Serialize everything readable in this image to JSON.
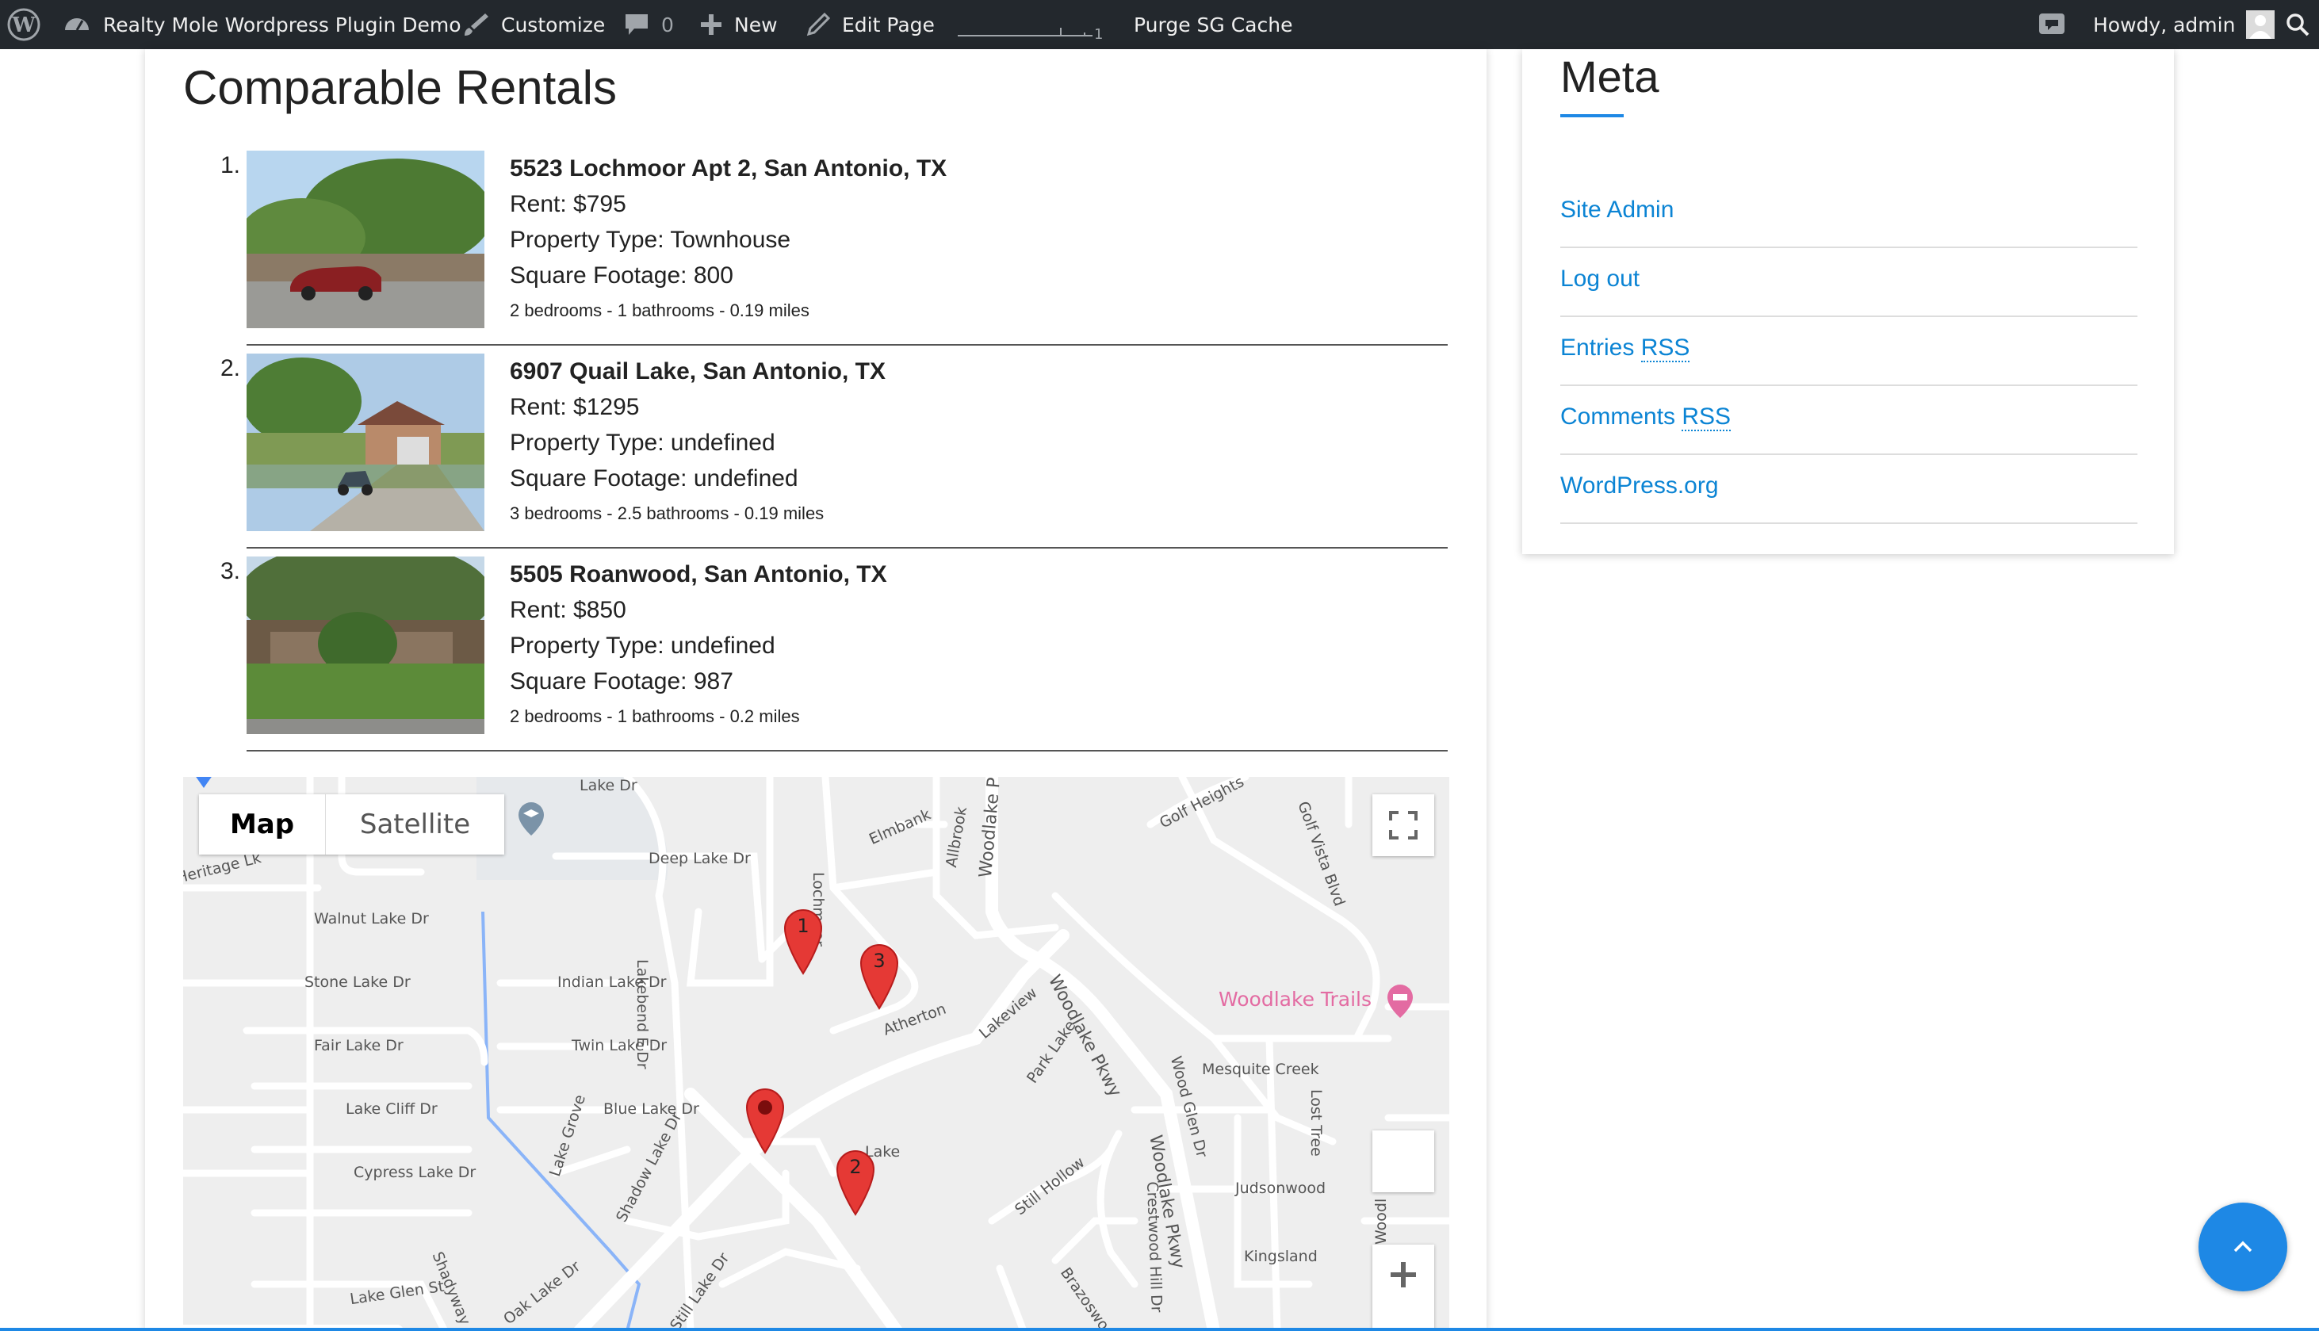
{
  "adminbar": {
    "site_name": "Realty Mole Wordpress Plugin Demo",
    "customize": "Customize",
    "comments_count": "0",
    "new": "New",
    "edit_page": "Edit Page",
    "purge": "Purge SG Cache",
    "howdy": "Howdy, admin"
  },
  "page": {
    "title": "Comparable Rentals"
  },
  "rentals": [
    {
      "number": "1.",
      "address": "5523 Lochmoor Apt 2, San Antonio, TX",
      "rent": "Rent: $795",
      "type": "Property Type: Townhouse",
      "sqft": "Square Footage: 800",
      "summary": "2 bedrooms - 1 bathrooms - 0.19 miles"
    },
    {
      "number": "2.",
      "address": "6907 Quail Lake, San Antonio, TX",
      "rent": "Rent: $1295",
      "type": "Property Type: undefined",
      "sqft": "Square Footage: undefined",
      "summary": "3 bedrooms - 2.5 bathrooms - 0.19 miles"
    },
    {
      "number": "3.",
      "address": "5505 Roanwood, San Antonio, TX",
      "rent": "Rent: $850",
      "type": "Property Type: undefined",
      "sqft": "Square Footage: 987",
      "summary": "2 bedrooms - 1 bathrooms - 0.2 miles"
    }
  ],
  "map": {
    "map_tab": "Map",
    "satellite_tab": "Satellite",
    "markers": [
      "1",
      "3",
      "2"
    ],
    "streets": {
      "walnut": "Walnut Lake Dr",
      "stone": "Stone Lake Dr",
      "fair": "Fair Lake Dr",
      "cliff": "Lake Cliff Dr",
      "cypress": "Cypress Lake Dr",
      "glen": "Lake Glen St",
      "deep": "Deep Lake Dr",
      "indian": "Indian Lake Dr",
      "twin": "Twin Lake Dr",
      "blue": "Blue Lake Dr",
      "lakebend": "Lakebend E Dr",
      "lakegrove": "Lake Grove",
      "shadowlake": "Shadow Lake Dr",
      "shadyway": "Shadyway",
      "oaklake": "Oak Lake Dr",
      "stilllake": "Still Lake Dr",
      "elmbank": "Elmbank",
      "allbrook": "Allbrook",
      "lochmoor": "Lochmoor",
      "atherton": "Atherton",
      "lakeview": "Lakeview",
      "parklake": "Park Lake",
      "stillhollow": "Still Hollow",
      "woodlakepkwy1": "Woodlake Pkwy",
      "woodlakepkwy2": "Woodlake Pkwy",
      "woodlakepkwy3": "Woodlake Pkwy",
      "woodglen": "Wood Glen Dr",
      "mesquite": "Mesquite Creek",
      "losttree": "Lost Tree",
      "judsonwood": "Judsonwood",
      "kingsland": "Kingsland",
      "crestwood": "Crestwood Hill Dr",
      "brazoswood": "Brazoswood",
      "golfheights": "Golf Heights",
      "golfvista": "Golf Vista Blvd",
      "heritage": "Heritage Lk",
      "qlake": "Lake",
      "topclip": "Lake Dr",
      "woodl": "Woodl"
    },
    "poi": "Woodlake Trails"
  },
  "sidebar": {
    "title": "Meta",
    "links": [
      {
        "pre": "Site Admin",
        "abbr": ""
      },
      {
        "pre": "Log out",
        "abbr": ""
      },
      {
        "pre": "Entries ",
        "abbr": "RSS"
      },
      {
        "pre": "Comments ",
        "abbr": "RSS"
      },
      {
        "pre": "WordPress.org",
        "abbr": ""
      }
    ]
  },
  "colors": {
    "adminbar_bg": "#23282d",
    "link": "#0b84d4",
    "accent": "#1e88e5",
    "marker": "#e53935",
    "poi": "#e36ba2"
  }
}
